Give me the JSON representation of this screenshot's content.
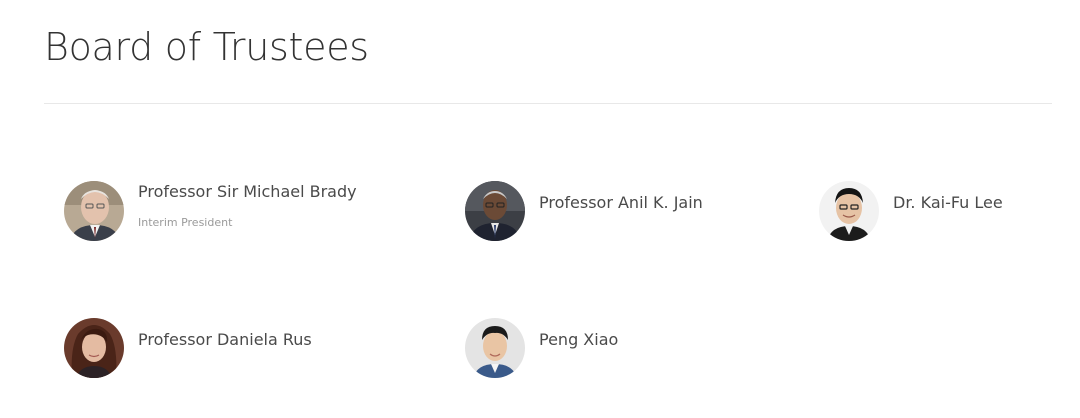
{
  "page": {
    "title": "Board of Trustees"
  },
  "trustees": [
    {
      "name": "Professor Sir Michael Brady",
      "role": "Interim President",
      "avatar": "portrait-photo"
    },
    {
      "name": "Professor Anil K. Jain",
      "role": "",
      "avatar": "portrait-photo"
    },
    {
      "name": "Dr. Kai-Fu Lee",
      "role": "",
      "avatar": "portrait-photo"
    },
    {
      "name": "Professor Daniela Rus",
      "role": "",
      "avatar": "portrait-photo"
    },
    {
      "name": "Peng Xiao",
      "role": "",
      "avatar": "portrait-photo"
    }
  ]
}
